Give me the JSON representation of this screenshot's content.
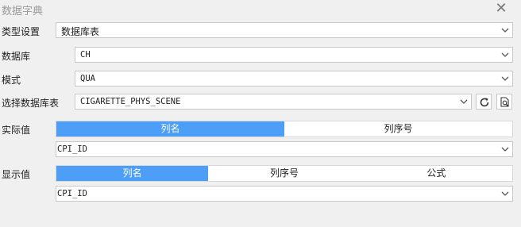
{
  "window": {
    "title": "数据字典",
    "close_icon": "close-icon"
  },
  "form": {
    "type_label": "类型设置",
    "type_value": "数据库表",
    "db_label": "数据库",
    "db_value": "CH",
    "schema_label": "模式",
    "schema_value": "QUA",
    "table_label": "选择数据库表",
    "table_value": "CIGARETTE_PHYS_SCENE",
    "actual_label": "实际值",
    "actual_tabs": [
      "列名",
      "列序号"
    ],
    "actual_selected_tab": "列名",
    "actual_value": "CPI_ID",
    "display_label": "显示值",
    "display_tabs": [
      "列名",
      "列序号",
      "公式"
    ],
    "display_selected_tab": "列名",
    "display_value": "CPI_ID"
  },
  "colors": {
    "accent": "#4d9ef7",
    "refresh_icon": "#333333"
  }
}
